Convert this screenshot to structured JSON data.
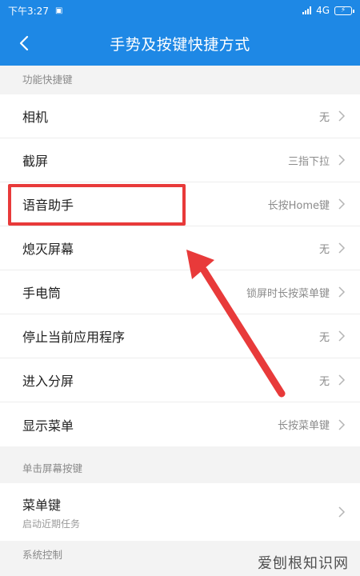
{
  "status": {
    "time": "下午3:27",
    "network": "4G",
    "battery_icon": "battery-charging-icon"
  },
  "header": {
    "title": "手势及按键快捷方式",
    "back_icon": "chevron-left-icon"
  },
  "sections": {
    "function": {
      "title": "功能快捷键",
      "items": [
        {
          "label": "相机",
          "value": "无"
        },
        {
          "label": "截屏",
          "value": "三指下拉"
        },
        {
          "label": "语音助手",
          "value": "长按Home键"
        },
        {
          "label": "熄灭屏幕",
          "value": "无"
        },
        {
          "label": "手电筒",
          "value": "锁屏时长按菜单键"
        },
        {
          "label": "停止当前应用程序",
          "value": "无"
        },
        {
          "label": "进入分屏",
          "value": "无"
        },
        {
          "label": "显示菜单",
          "value": "长按菜单键"
        }
      ]
    },
    "single": {
      "title": "单击屏幕按键",
      "item": {
        "label": "菜单键",
        "sublabel": "启动近期任务"
      }
    },
    "system": {
      "title": "系统控制"
    }
  },
  "watermark": "爱刨根知识网",
  "colors": {
    "accent": "#1e88e5",
    "annotation": "#e83a3a"
  }
}
